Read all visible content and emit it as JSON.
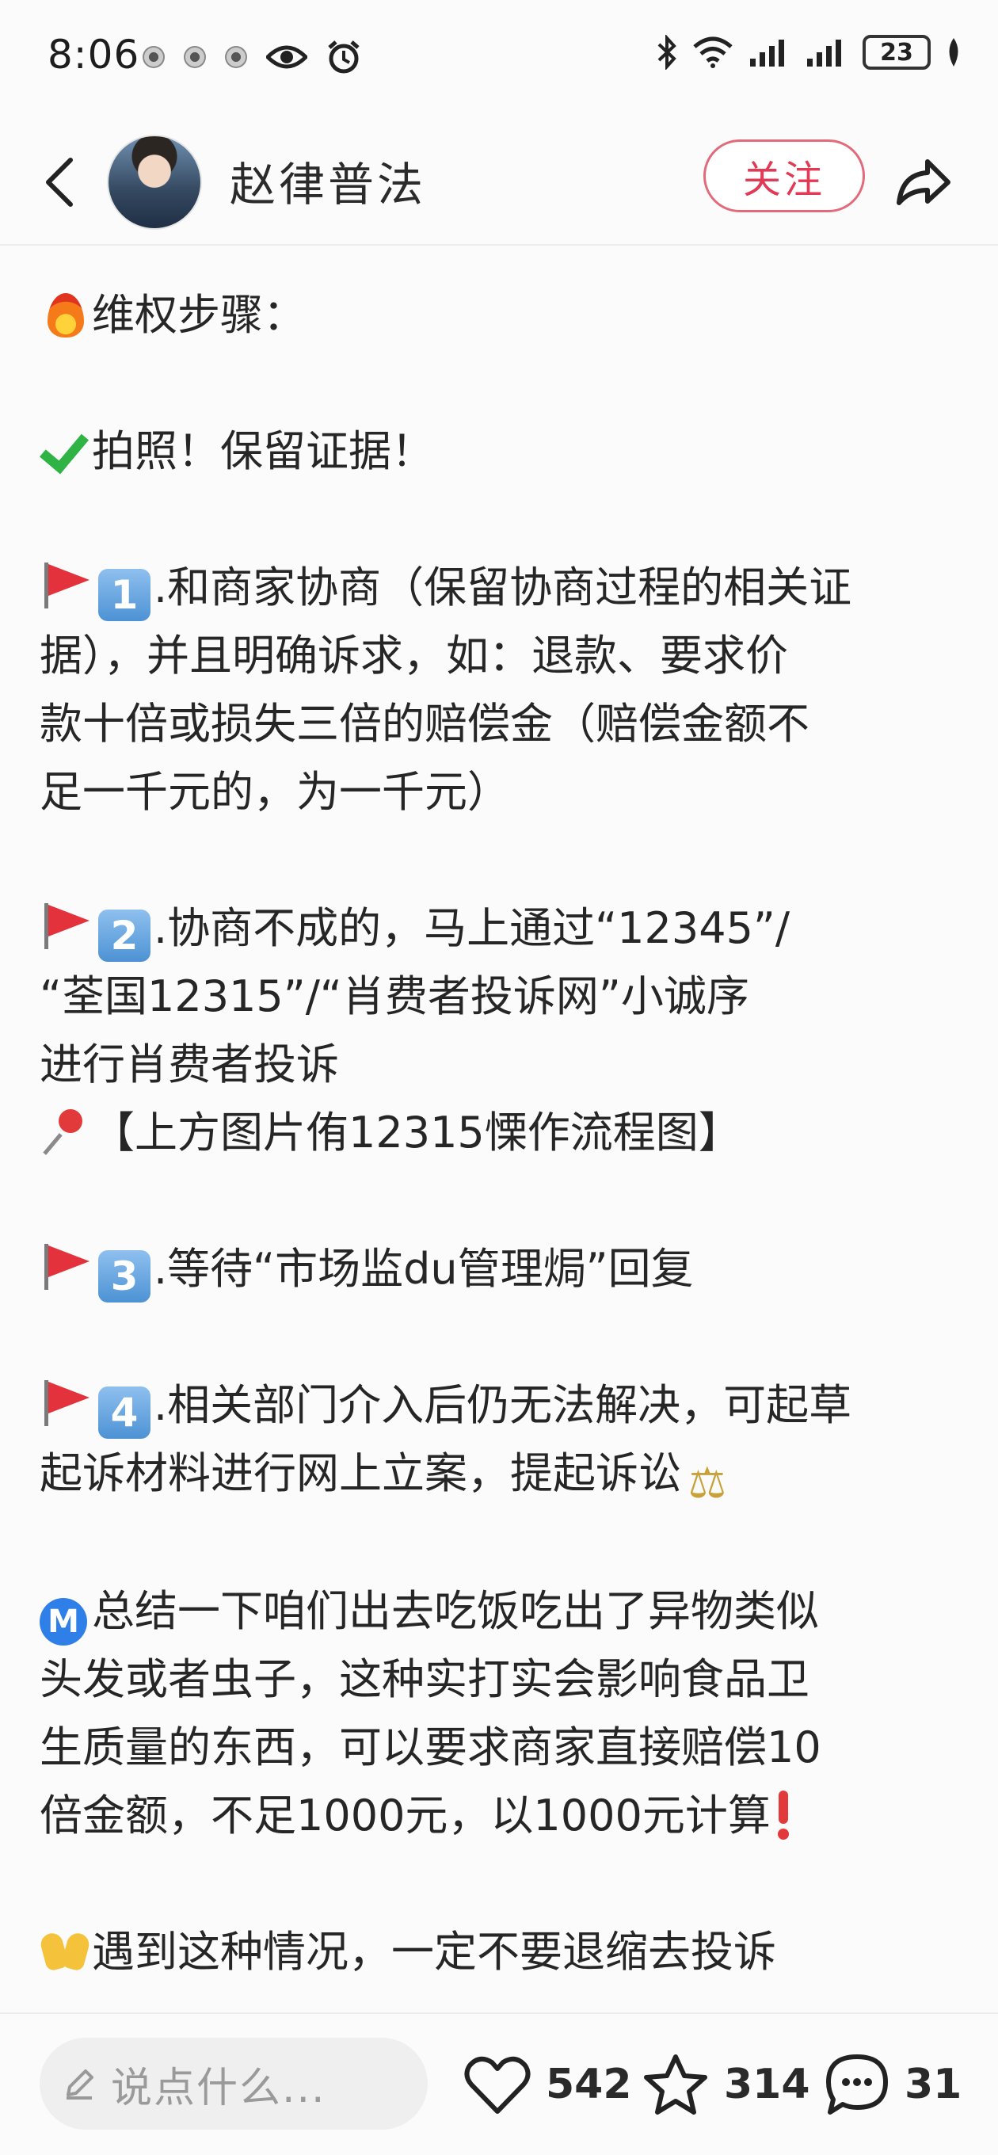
{
  "status_bar": {
    "time": "8:06",
    "battery": "23"
  },
  "header": {
    "author_name": "赵律普法",
    "follow_label": "关注"
  },
  "content": {
    "heading": "维权步骤：",
    "evidence": "拍照！保留证据！",
    "step1_num": "1",
    "step1_line1": ".和商家协商（保留协商过程的相关证",
    "step1_line2": "据），并且明确诉求，如：退款、要求价",
    "step1_line3": "款十倍或损失三倍的赔偿金（赔偿金额不",
    "step1_line4": "足一千元的，为一千元）",
    "step2_num": "2",
    "step2_line1": ".协商不成的，马上通过“12345”/",
    "step2_line2": "“荃国12315”/“肖费者投诉网”小诚序",
    "step2_line3": "进行肖费者投诉",
    "step2_pin_line": "【上方图片侑12315慄作流程图】",
    "step3_num": "3",
    "step3_line1": ".等待“市场监du管理焗”回复",
    "step4_num": "4",
    "step4_line1": ".相关部门介入后仍无法解决，可起草",
    "step4_line2": "起诉材料进行网上立案，提起诉讼",
    "summary_badge": "M",
    "summary_line1": "总结一下咱们出去吃饭吃出了异物类似",
    "summary_line2": "头发或者虫子，这种实打实会影响食品卫",
    "summary_line3": "生质量的东西，可以要求商家直接赔偿10",
    "summary_line4": "倍金额，不足1000元，以1000元计算",
    "closing": "遇到这种情况，一定不要退缩去投诉"
  },
  "bottom_bar": {
    "comment_placeholder": "说点什么...",
    "likes": "542",
    "favorites": "314",
    "comments": "31"
  },
  "colors": {
    "accent_red": "#e23a55",
    "number_box_blue": "#4d92d4"
  }
}
